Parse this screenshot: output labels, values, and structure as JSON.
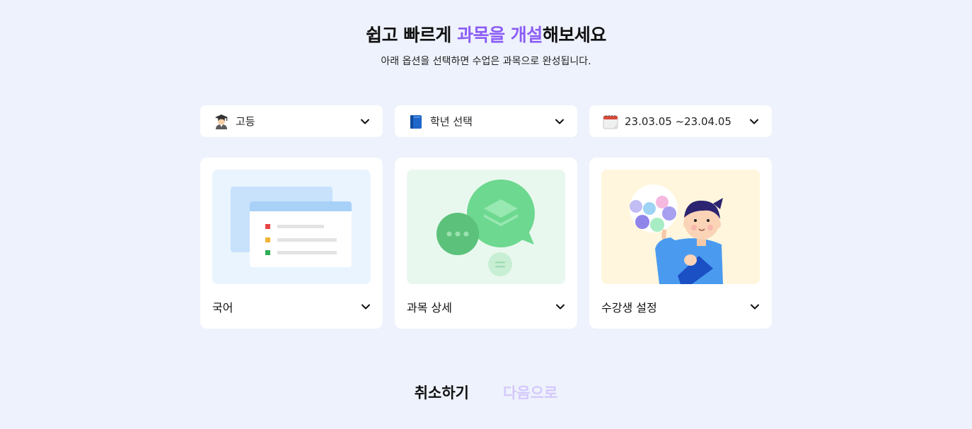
{
  "header": {
    "title_prefix": "쉽고 빠르게 ",
    "title_accent": "과목을 개설",
    "title_suffix": "해보세요",
    "subtitle": "아래 옵션을 선택하면 수업은 과목으로 완성됩니다."
  },
  "selects": [
    {
      "label": "고등",
      "icon": "student-emoji-icon"
    },
    {
      "label": "학년 선택",
      "icon": "book-emoji-icon"
    },
    {
      "label": "23.03.05 ~23.04.05",
      "icon": "calendar-emoji-icon"
    }
  ],
  "cards": [
    {
      "label": "국어",
      "icon": "list-window-illustration"
    },
    {
      "label": "과목 상세",
      "icon": "chat-bubbles-illustration"
    },
    {
      "label": "수강생 설정",
      "icon": "student-thinking-illustration"
    }
  ],
  "actions": {
    "cancel": "취소하기",
    "next": "다음으로"
  },
  "colors": {
    "background": "#eef2fc",
    "accent": "#8b5cf6",
    "next_disabled": "#d4c8fb"
  }
}
